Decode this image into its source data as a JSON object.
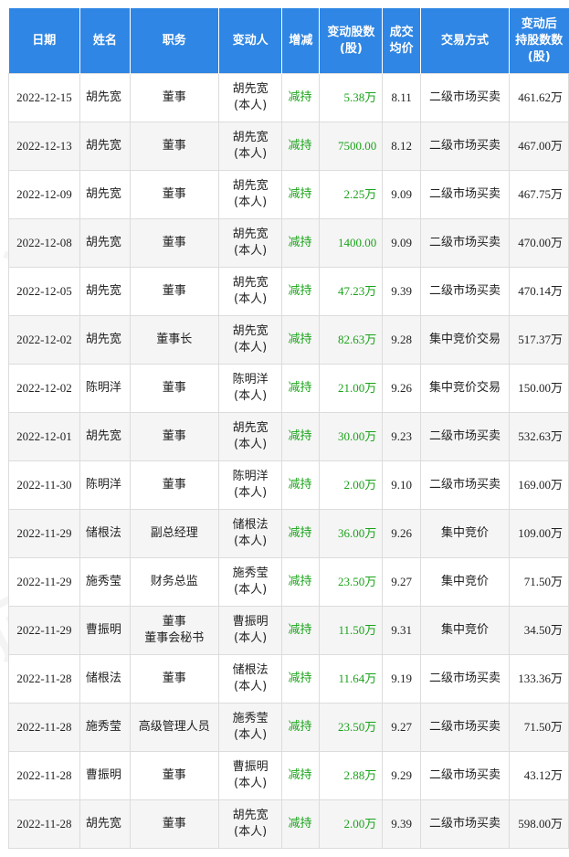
{
  "header": {
    "date": "日期",
    "name": "姓名",
    "position": "职务",
    "changer": "变动人",
    "action": "增减",
    "shares_l1": "变动股数",
    "shares_l2": "(股)",
    "price_l1": "成交",
    "price_l2": "均价",
    "type": "交易方式",
    "after_l1": "变动后",
    "after_l2": "持股数数",
    "after_l3": "(股)"
  },
  "rows": [
    {
      "date": "2022-12-15",
      "name": "胡先宽",
      "position": [
        "董事"
      ],
      "changer": "胡先宽",
      "changer_note": "(本人)",
      "action": "减持",
      "shares": "5.38万",
      "price": "8.11",
      "type": "二级市场买卖",
      "after": "461.62万"
    },
    {
      "date": "2022-12-13",
      "name": "胡先宽",
      "position": [
        "董事"
      ],
      "changer": "胡先宽",
      "changer_note": "(本人)",
      "action": "减持",
      "shares": "7500.00",
      "price": "8.12",
      "type": "二级市场买卖",
      "after": "467.00万"
    },
    {
      "date": "2022-12-09",
      "name": "胡先宽",
      "position": [
        "董事"
      ],
      "changer": "胡先宽",
      "changer_note": "(本人)",
      "action": "减持",
      "shares": "2.25万",
      "price": "9.09",
      "type": "二级市场买卖",
      "after": "467.75万"
    },
    {
      "date": "2022-12-08",
      "name": "胡先宽",
      "position": [
        "董事"
      ],
      "changer": "胡先宽",
      "changer_note": "(本人)",
      "action": "减持",
      "shares": "1400.00",
      "price": "9.09",
      "type": "二级市场买卖",
      "after": "470.00万"
    },
    {
      "date": "2022-12-05",
      "name": "胡先宽",
      "position": [
        "董事"
      ],
      "changer": "胡先宽",
      "changer_note": "(本人)",
      "action": "减持",
      "shares": "47.23万",
      "price": "9.39",
      "type": "二级市场买卖",
      "after": "470.14万"
    },
    {
      "date": "2022-12-02",
      "name": "胡先宽",
      "position": [
        "董事长"
      ],
      "changer": "胡先宽",
      "changer_note": "(本人)",
      "action": "减持",
      "shares": "82.63万",
      "price": "9.28",
      "type": "集中竞价交易",
      "after": "517.37万"
    },
    {
      "date": "2022-12-02",
      "name": "陈明洋",
      "position": [
        "董事"
      ],
      "changer": "陈明洋",
      "changer_note": "(本人)",
      "action": "减持",
      "shares": "21.00万",
      "price": "9.26",
      "type": "集中竞价交易",
      "after": "150.00万"
    },
    {
      "date": "2022-12-01",
      "name": "胡先宽",
      "position": [
        "董事"
      ],
      "changer": "胡先宽",
      "changer_note": "(本人)",
      "action": "减持",
      "shares": "30.00万",
      "price": "9.23",
      "type": "二级市场买卖",
      "after": "532.63万"
    },
    {
      "date": "2022-11-30",
      "name": "陈明洋",
      "position": [
        "董事"
      ],
      "changer": "陈明洋",
      "changer_note": "(本人)",
      "action": "减持",
      "shares": "2.00万",
      "price": "9.10",
      "type": "二级市场买卖",
      "after": "169.00万"
    },
    {
      "date": "2022-11-29",
      "name": "储根法",
      "position": [
        "副总经理"
      ],
      "changer": "储根法",
      "changer_note": "(本人)",
      "action": "减持",
      "shares": "36.00万",
      "price": "9.26",
      "type": "集中竞价",
      "after": "109.00万"
    },
    {
      "date": "2022-11-29",
      "name": "施秀莹",
      "position": [
        "财务总监"
      ],
      "changer": "施秀莹",
      "changer_note": "(本人)",
      "action": "减持",
      "shares": "23.50万",
      "price": "9.27",
      "type": "集中竞价",
      "after": "71.50万"
    },
    {
      "date": "2022-11-29",
      "name": "曹振明",
      "position": [
        "董事",
        "董事会秘书"
      ],
      "changer": "曹振明",
      "changer_note": "(本人)",
      "action": "减持",
      "shares": "11.50万",
      "price": "9.31",
      "type": "集中竞价",
      "after": "34.50万"
    },
    {
      "date": "2022-11-28",
      "name": "储根法",
      "position": [
        "董事"
      ],
      "changer": "储根法",
      "changer_note": "(本人)",
      "action": "减持",
      "shares": "11.64万",
      "price": "9.19",
      "type": "二级市场买卖",
      "after": "133.36万"
    },
    {
      "date": "2022-11-28",
      "name": "施秀莹",
      "position": [
        "高级管理人员"
      ],
      "changer": "施秀莹",
      "changer_note": "(本人)",
      "action": "减持",
      "shares": "23.50万",
      "price": "9.27",
      "type": "二级市场买卖",
      "after": "71.50万"
    },
    {
      "date": "2022-11-28",
      "name": "曹振明",
      "position": [
        "董事"
      ],
      "changer": "曹振明",
      "changer_note": "(本人)",
      "action": "减持",
      "shares": "2.88万",
      "price": "9.29",
      "type": "二级市场买卖",
      "after": "43.12万"
    },
    {
      "date": "2022-11-28",
      "name": "胡先宽",
      "position": [
        "董事"
      ],
      "changer": "胡先宽",
      "changer_note": "(本人)",
      "action": "减持",
      "shares": "2.00万",
      "price": "9.39",
      "type": "二级市场买卖",
      "after": "598.00万"
    }
  ],
  "watermark": "证券之星",
  "colors": {
    "header_bg": "#2f86e4",
    "decrease_green": "#1aa31a",
    "row_alt": "#f5f5f5",
    "border": "#dcdcdc"
  }
}
